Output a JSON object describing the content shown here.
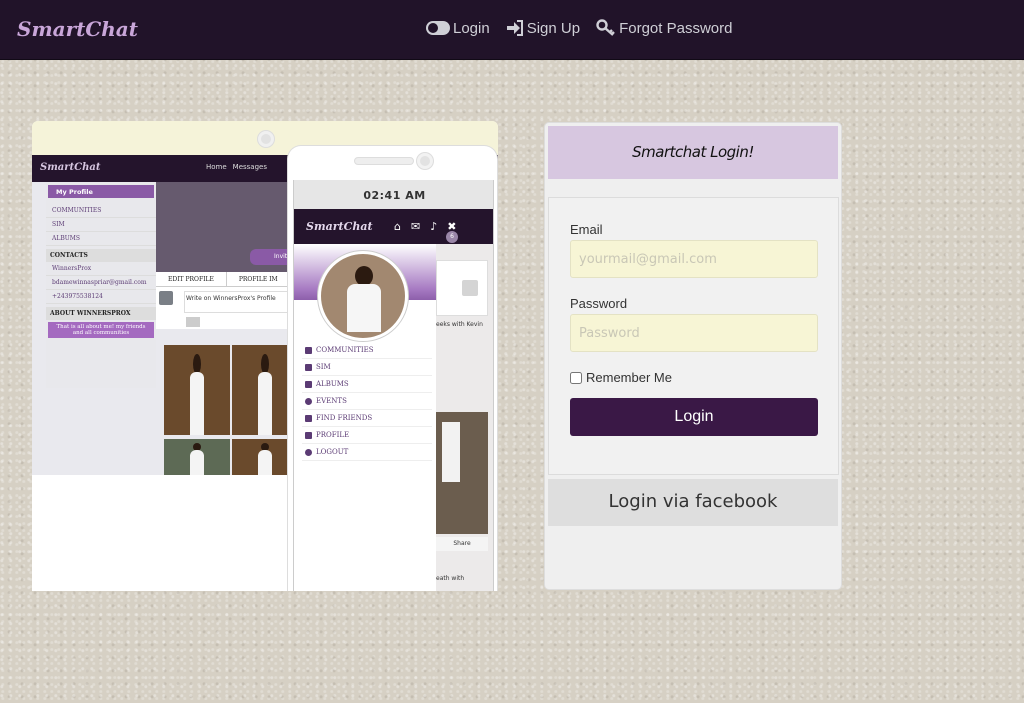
{
  "app": {
    "brand": "SmartChat"
  },
  "nav": {
    "login": "Login",
    "signup": "Sign Up",
    "forgot": "Forgot Password",
    "login_icon": "toggle-icon",
    "signup_icon": "sign-in-icon",
    "forgot_icon": "key-icon"
  },
  "preview": {
    "desktop": {
      "brand": "SmartChat",
      "nav_home": "Home",
      "nav_messages": "Messages",
      "side_head": "My Profile",
      "side_items": [
        "COMMUNITIES",
        "SIM",
        "ALBUMS"
      ],
      "contacts_title": "CONTACTS",
      "contacts": [
        "WinnersProx",
        "bdamewinnaspriar@gmail.com",
        "+243975538124"
      ],
      "about_title": "ABOUT WINNERSPROX",
      "about_text": "That is all about me! my friends and all communities",
      "invite": "Invit",
      "tab_edit": "EDIT PROFILE",
      "tab_profile": "PROFILE IM",
      "write_placeholder": "Write on WinnersProx's Profile"
    },
    "phone": {
      "time": "02:41 AM",
      "brand": "SmartChat",
      "badge": "6",
      "menu": [
        "COMMUNITIES",
        "SIM",
        "ALBUMS",
        "EVENTS",
        "FIND FRIENDS",
        "PROFILE",
        "LOGOUT"
      ],
      "feed_text_1": "eeks  with Kevin",
      "share": "Share",
      "feed_text_2": "eath  with"
    }
  },
  "login": {
    "title": "Smartchat Login!",
    "email_label": "Email",
    "email_placeholder": "yourmail@gmail.com",
    "password_label": "Password",
    "password_placeholder": "Password",
    "remember": "Remember Me",
    "submit": "Login",
    "facebook": "Login via facebook"
  },
  "colors": {
    "nav_bg": "#211329",
    "accent": "#3a1846",
    "login_header": "#d7c7e0",
    "input_bg": "#f7f5d5"
  }
}
